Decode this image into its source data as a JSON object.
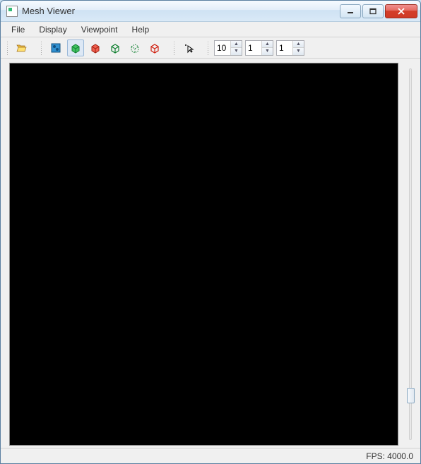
{
  "window": {
    "title": "Mesh Viewer"
  },
  "menus": {
    "file": "File",
    "display": "Display",
    "viewpoint": "Viewpoint",
    "help": "Help"
  },
  "spinners": {
    "a": "10",
    "b": "1",
    "c": "1"
  },
  "status": {
    "fps_label": "FPS: 4000.0"
  }
}
